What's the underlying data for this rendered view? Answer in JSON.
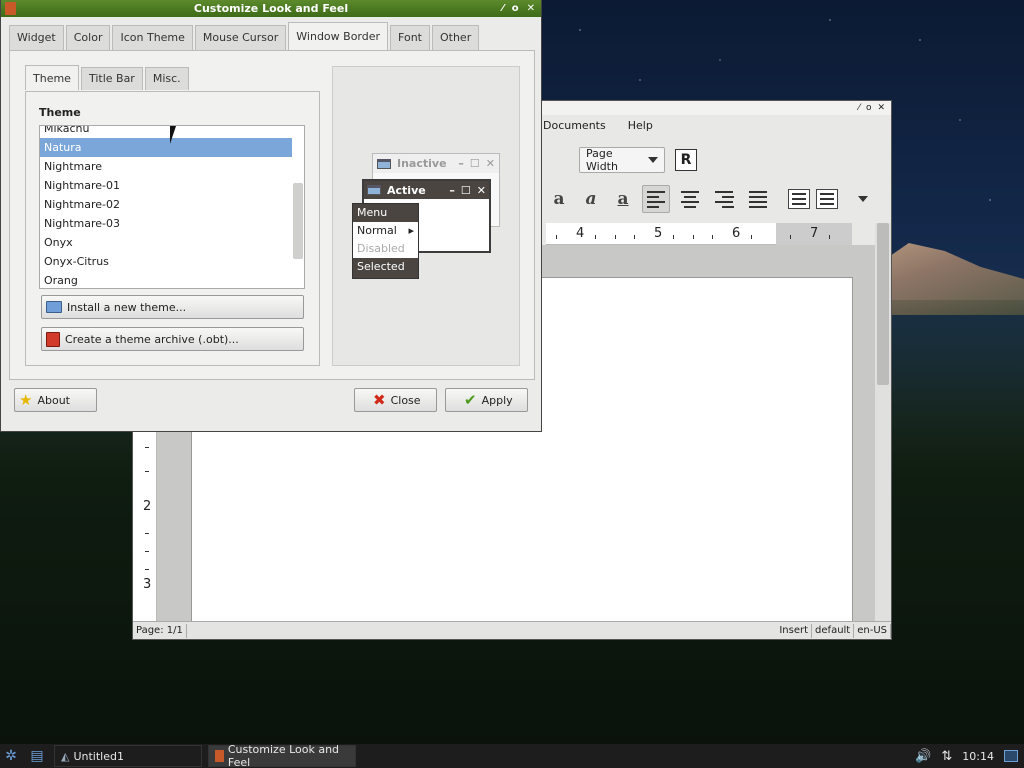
{
  "dialog": {
    "title": "Customize Look and Feel",
    "tabs": [
      "Widget",
      "Color",
      "Icon Theme",
      "Mouse Cursor",
      "Window Border",
      "Font",
      "Other"
    ],
    "active_tab": "Window Border",
    "subtabs": [
      "Theme",
      "Title Bar",
      "Misc."
    ],
    "active_subtab": "Theme",
    "theme_section_label": "Theme",
    "themes": [
      "Mikachu",
      "Natura",
      "Nightmare",
      "Nightmare-01",
      "Nightmare-02",
      "Nightmare-03",
      "Onyx",
      "Onyx-Citrus",
      "Orang"
    ],
    "selected_theme": "Natura",
    "install_button": "Install a new theme...",
    "archive_button": "Create a theme archive (.obt)...",
    "about_button": "About",
    "close_button": "Close",
    "apply_button": "Apply",
    "preview": {
      "inactive_title": "Inactive",
      "active_title": "Active",
      "menu_title": "Menu",
      "menu_normal": "Normal",
      "menu_disabled": "Disabled",
      "menu_selected": "Selected"
    }
  },
  "writer": {
    "menus": [
      "Documents",
      "Help"
    ],
    "zoom_select": "Page Width",
    "ruler_numbers": [
      "4",
      "5",
      "6",
      "7"
    ],
    "vruler_numbers": [
      "2",
      "3"
    ],
    "status": [
      "Page: 1/1",
      "Insert",
      "default",
      "en-US"
    ]
  },
  "taskbar": {
    "tasks": [
      "Untitled1",
      "Customize Look and Feel"
    ],
    "clock": "10:14"
  },
  "colors": {
    "titlebar_green": "#4a7a22",
    "selection_blue": "#7ba6d9",
    "preview_dark": "#4a4541"
  }
}
